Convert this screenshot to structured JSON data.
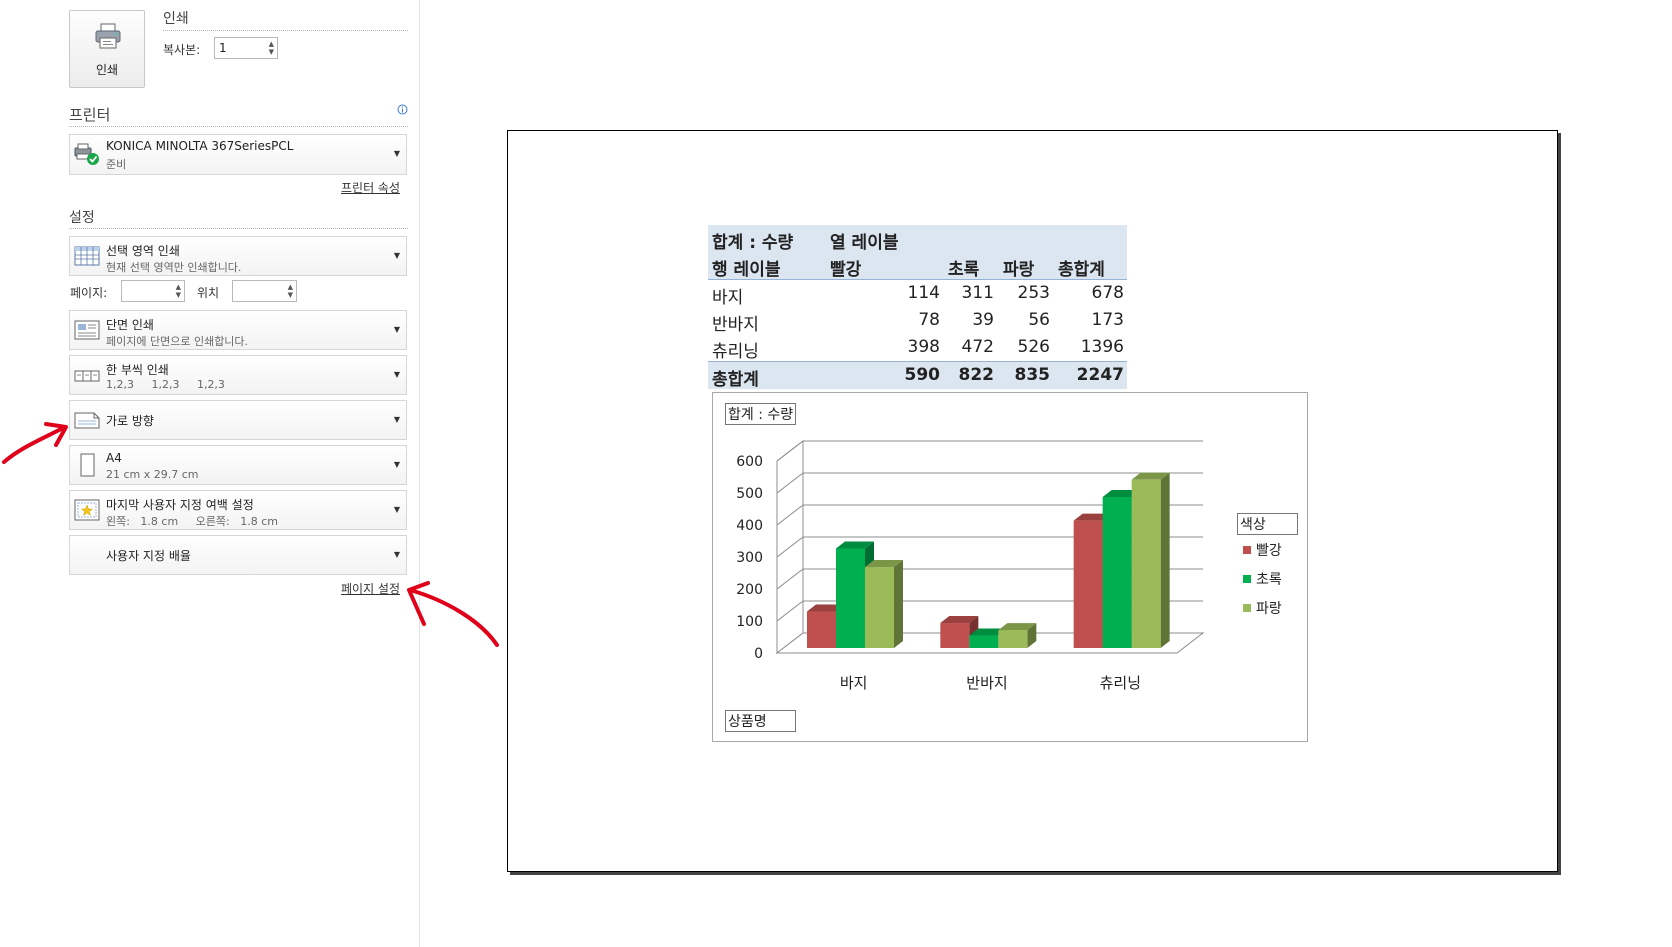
{
  "print": {
    "section_title": "인쇄",
    "button_label": "인쇄",
    "copies_label": "복사본:",
    "copies_value": "1"
  },
  "printer": {
    "section_title": "프린터",
    "name": "KONICA MINOLTA 367SeriesPCL",
    "status": "준비",
    "properties_link": "프린터 속성"
  },
  "settings": {
    "section_title": "설정",
    "print_what": {
      "title": "선택 영역 인쇄",
      "subtitle": "현재 선택 영역만 인쇄합니다."
    },
    "pages_label": "페이지:",
    "pages_value": "",
    "to_label": "위치",
    "to_value": "",
    "sides": {
      "title": "단면 인쇄",
      "subtitle": "페이지에 단면으로 인쇄합니다."
    },
    "collate": {
      "title": "한 부씩 인쇄",
      "subtitle": "1,2,3     1,2,3     1,2,3"
    },
    "orientation": {
      "title": "가로 방향"
    },
    "paper": {
      "title": "A4",
      "subtitle": "21 cm x 29.7 cm"
    },
    "margins": {
      "title": "마지막 사용자 지정 여백 설정",
      "subtitle": "왼쪽:   1.8 cm     오른쪽:   1.8 cm"
    },
    "scaling": {
      "title": "사용자 지정 배율"
    },
    "page_setup_link": "페이지 설정"
  },
  "pivot_table": {
    "header1": {
      "values_label": "합계 : 수량",
      "columns_label": "열 레이블"
    },
    "header2": {
      "rows_label": "행 레이블",
      "cols": [
        "빨강",
        "초록",
        "파랑",
        "총합계"
      ]
    },
    "rows": [
      {
        "label": "바지",
        "values": [
          "114",
          "311",
          "253",
          "678"
        ]
      },
      {
        "label": "반바지",
        "values": [
          "78",
          "39",
          "56",
          "173"
        ]
      },
      {
        "label": "츄리닝",
        "values": [
          "398",
          "472",
          "526",
          "1396"
        ]
      }
    ],
    "total": {
      "label": "총합계",
      "values": [
        "590",
        "822",
        "835",
        "2247"
      ]
    }
  },
  "chart_data": {
    "type": "bar",
    "title": "",
    "values_field": "합계 : 수량",
    "axis_field": "상품명",
    "legend_field": "색상",
    "categories": [
      "바지",
      "반바지",
      "츄리닝"
    ],
    "series": [
      {
        "name": "빨강",
        "values": [
          114,
          78,
          398
        ],
        "color": "#c0504d"
      },
      {
        "name": "초록",
        "values": [
          311,
          39,
          472
        ],
        "color": "#00b050"
      },
      {
        "name": "파랑",
        "values": [
          253,
          56,
          526
        ],
        "color": "#9bbb59"
      }
    ],
    "yticks": [
      "0",
      "100",
      "200",
      "300",
      "400",
      "500",
      "600"
    ],
    "ylim": [
      0,
      600
    ],
    "grid": true,
    "legend_position": "right",
    "style": "3d-clustered-column"
  },
  "colors": {
    "annotation_arrow": "#e0001a",
    "pivot_header_bg": "#dce6f1"
  }
}
